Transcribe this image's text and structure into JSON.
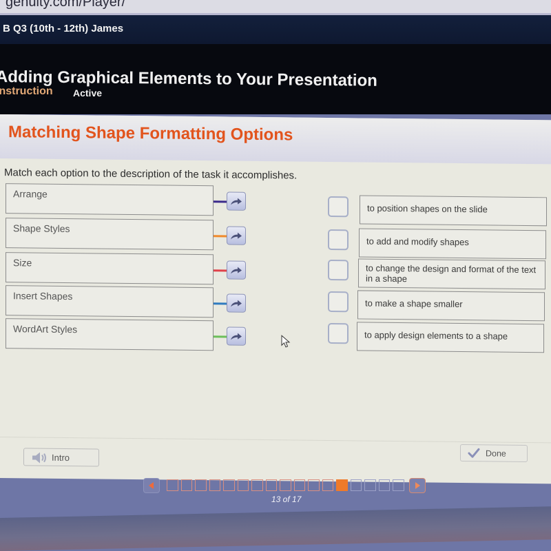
{
  "browser": {
    "url_fragment": "genuity.com/Player/"
  },
  "course": {
    "title": "B Q3 (10th - 12th) James"
  },
  "lesson": {
    "title": "Adding Graphical Elements to Your Presentation",
    "tabs": [
      {
        "label": "Instruction",
        "state": "current"
      },
      {
        "label": "Active",
        "state": "default"
      }
    ]
  },
  "activity": {
    "title": "Matching Shape Formatting Options",
    "instructions": "Match each option to the description of the task it accomplishes.",
    "options": [
      {
        "label": "Arrange",
        "connector_color": "#3b2a8c"
      },
      {
        "label": "Shape Styles",
        "connector_color": "#f08a2c"
      },
      {
        "label": "Size",
        "connector_color": "#e0414a"
      },
      {
        "label": "Insert Shapes",
        "connector_color": "#2f7bc0"
      },
      {
        "label": "WordArt Styles",
        "connector_color": "#6cbf5a"
      }
    ],
    "descriptions": [
      {
        "text": "to position shapes on the slide"
      },
      {
        "text": "to add and modify shapes"
      },
      {
        "text": "to change the design and format of the text in a shape"
      },
      {
        "text": "to make a shape smaller"
      },
      {
        "text": "to apply design elements to a shape"
      }
    ]
  },
  "footer": {
    "intro_label": "Intro",
    "done_label": "Done"
  },
  "pagination": {
    "current": 13,
    "total": 17,
    "counter_text": "13 of 17",
    "current_color": "#ef7a2a"
  },
  "icons": {
    "arrow_button": "curved-arrow-right-icon",
    "intro": "speaker-icon",
    "done": "checkmark-icon",
    "prev": "triangle-left-icon",
    "next": "triangle-right-icon"
  }
}
